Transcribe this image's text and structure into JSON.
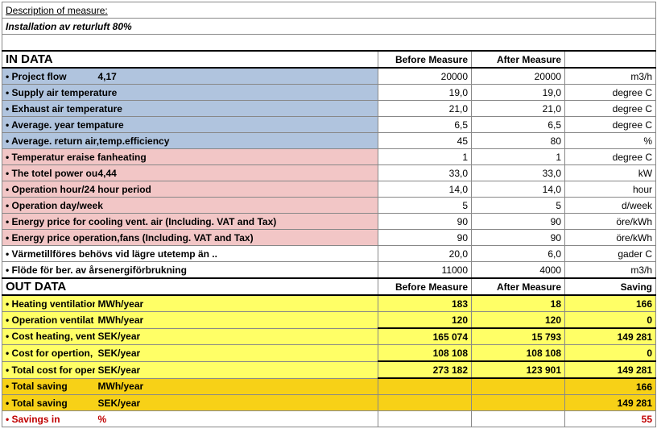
{
  "header": {
    "desc_label": "Description of measure:",
    "desc_value": "Installation av returluft 80%"
  },
  "in_data": {
    "title": "IN DATA",
    "before": "Before Measure",
    "after": "After Measure",
    "rows": [
      {
        "bullet": "• Project flow",
        "extra": "4,17",
        "b": "20000",
        "a": "20000",
        "u": "m3/h",
        "cls": "blue"
      },
      {
        "bullet": "• Supply air temperature",
        "extra": "",
        "b": "19,0",
        "a": "19,0",
        "u": "degree C",
        "cls": "blue"
      },
      {
        "bullet": "• Exhaust air temperature",
        "extra": "",
        "b": "21,0",
        "a": "21,0",
        "u": "degree C",
        "cls": "blue"
      },
      {
        "bullet": "• Average. year tempature",
        "extra": "",
        "b": "6,5",
        "a": "6,5",
        "u": "degree C",
        "cls": "blue"
      },
      {
        "bullet": "• Average. return air,temp.efficiency",
        "extra": "",
        "b": "45",
        "a": "80",
        "u": "%",
        "cls": "blue"
      },
      {
        "bullet": "• Temperatur eraise fanheating",
        "extra": "",
        "b": "1",
        "a": "1",
        "u": "degree C",
        "cls": "pink"
      },
      {
        "bullet": "• The totel power ou",
        "extra": "4,44",
        "b": "33,0",
        "a": "33,0",
        "u": "kW",
        "cls": "pink"
      },
      {
        "bullet": "• Operation hour/24 hour period",
        "extra": "",
        "b": "14,0",
        "a": "14,0",
        "u": "hour",
        "cls": "pink"
      },
      {
        "bullet": "• Operation day/week",
        "extra": "",
        "b": "5",
        "a": "5",
        "u": "d/week",
        "cls": "pink"
      },
      {
        "bullet": "• Energy price for cooling  vent. air (Including. VAT and Tax)",
        "extra": "",
        "b": "90",
        "a": "90",
        "u": "öre/kWh",
        "cls": "pink"
      },
      {
        "bullet": "• Energy price  operation,fans  (Including. VAT and Tax)",
        "extra": "",
        "b": "90",
        "a": "90",
        "u": "öre/kWh",
        "cls": "pink"
      },
      {
        "bullet": "• Värmetillföres behövs vid lägre utetemp än ..",
        "extra": "",
        "b": "20,0",
        "a": "6,0",
        "u": "gader C",
        "cls": ""
      },
      {
        "bullet": "• Flöde för ber. av årsenergiförbrukning",
        "extra": "",
        "b": "11000",
        "a": "4000",
        "u": "m3/h",
        "cls": ""
      }
    ]
  },
  "out_data": {
    "title": "OUT DATA",
    "before": "Before Measure",
    "after": "After Measure",
    "saving": "Saving",
    "rows": [
      {
        "bullet": "• Heating ventilation",
        "unit": "MWh/year",
        "b": "183",
        "a": "18",
        "s": "166",
        "cls": "yellow"
      },
      {
        "bullet": "• Operation ventilat",
        "unit": "MWh/year",
        "b": "120",
        "a": "120",
        "s": "0",
        "cls": "yellow"
      },
      {
        "bullet": "• Cost  heating, vent",
        "unit": "SEK/year",
        "b": "165 074",
        "a": "15 793",
        "s": "149 281",
        "cls": "yellow",
        "tt": true
      },
      {
        "bullet": "• Cost for opertion, f",
        "unit": "SEK/year",
        "b": "108 108",
        "a": "108 108",
        "s": "0",
        "cls": "yellow"
      },
      {
        "bullet": "• Total cost  for oper",
        "unit": "SEK/year",
        "b": "273 182",
        "a": "123 901",
        "s": "149 281",
        "cls": "yellow",
        "tt": true,
        "tb": true
      },
      {
        "bullet": "• Total  saving",
        "unit": "MWh/year",
        "b": "",
        "a": "",
        "s": "166",
        "cls": "darkyellow"
      },
      {
        "bullet": "• Total saving",
        "unit": "SEK/year",
        "b": "",
        "a": "",
        "s": "149 281",
        "cls": "darkyellow"
      },
      {
        "bullet": "• Savings in",
        "unit": "%",
        "b": "",
        "a": "",
        "s": "55",
        "cls": "",
        "red": true
      }
    ]
  }
}
